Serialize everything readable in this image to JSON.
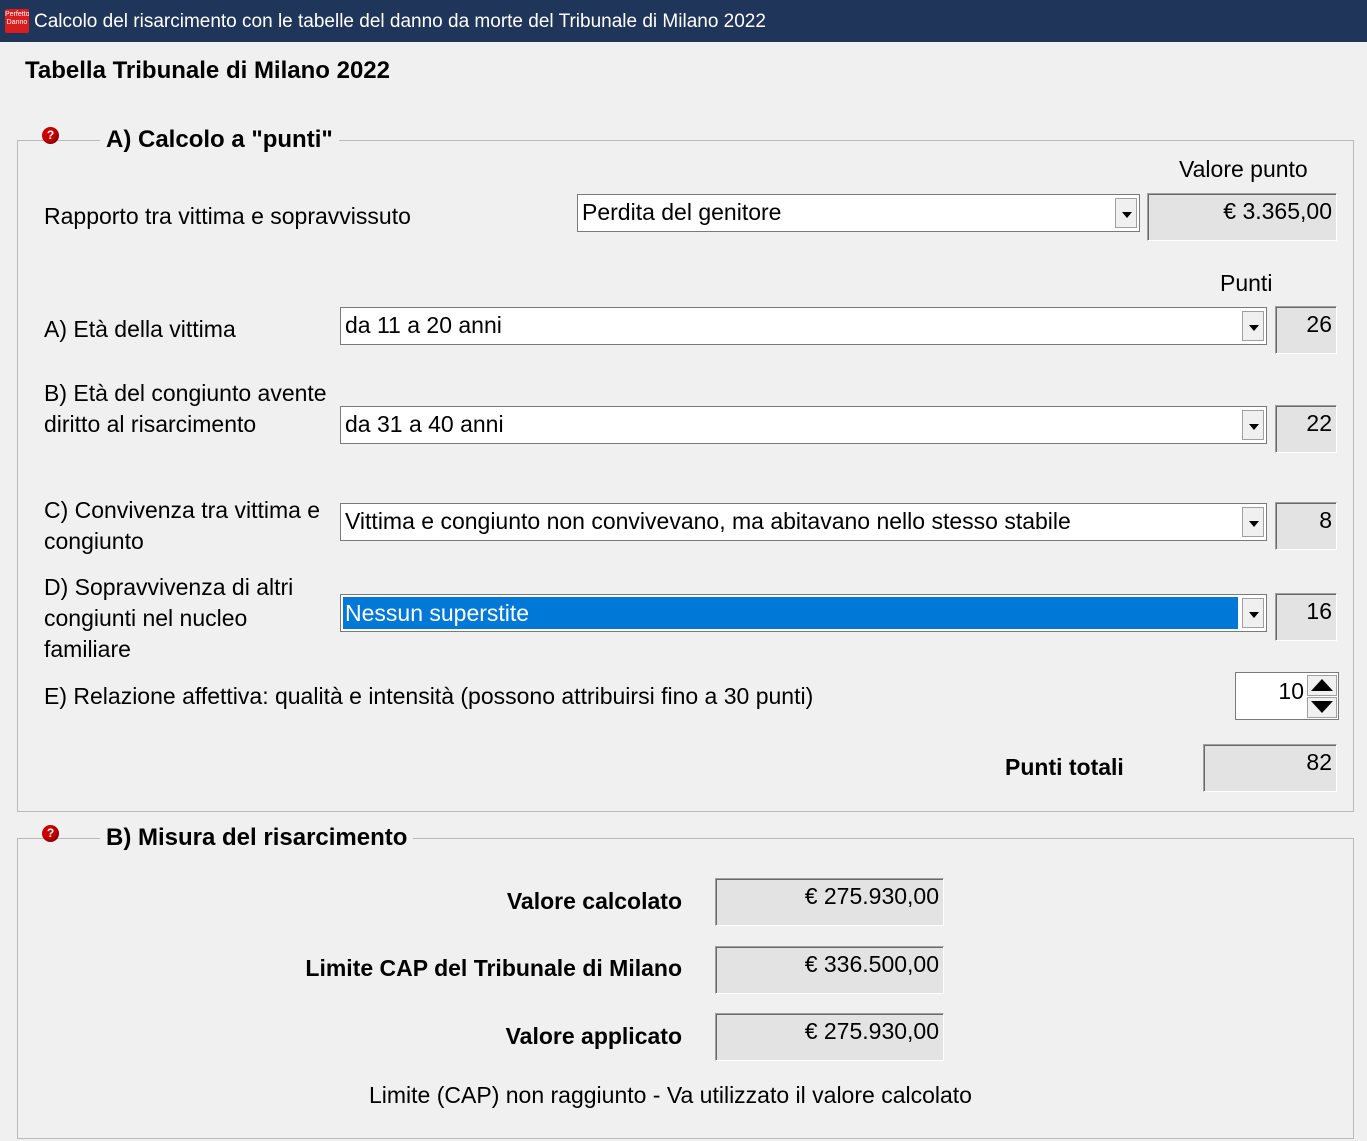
{
  "window": {
    "icon_text": "Perfetto Danno",
    "title": "Calcolo del risarcimento con le tabelle del danno da morte del Tribunale di Milano 2022"
  },
  "heading": "Tabella Tribunale di Milano 2022",
  "section_a": {
    "title": "A) Calcolo a \"punti\"",
    "help_icon": "?",
    "valore_punto_label": "Valore punto",
    "valore_punto": "€ 3.365,00",
    "rapporto_label": "Rapporto tra vittima e sopravvissuto",
    "rapporto_value": "Perdita del genitore",
    "punti_label": "Punti",
    "eta_vittima_label": "A) Età della vittima",
    "eta_vittima_value": "da 11 a 20 anni",
    "eta_vittima_punti": "26",
    "eta_congiunto_label_1": "B) Età del congiunto avente",
    "eta_congiunto_label_2": "diritto al risarcimento",
    "eta_congiunto_value": "da 31 a 40 anni",
    "eta_congiunto_punti": "22",
    "convivenza_label_1": "C) Convivenza tra vittima e",
    "convivenza_label_2": "congiunto",
    "convivenza_value": "Vittima e congiunto non convivevano, ma abitavano nello stesso stabile",
    "convivenza_punti": "8",
    "sopravvivenza_label_1": "D) Sopravvivenza di altri",
    "sopravvivenza_label_2": "congiunti nel nucleo",
    "sopravvivenza_label_3": "familiare",
    "sopravvivenza_value": "Nessun superstite",
    "sopravvivenza_punti": "16",
    "relazione_label": "E) Relazione affettiva: qualità e intensità (possono attribuirsi fino a 30 punti)",
    "relazione_punti": "10",
    "punti_totali_label": "Punti totali",
    "punti_totali": "82"
  },
  "section_b": {
    "title": "B) Misura del risarcimento",
    "help_icon": "?",
    "valore_calcolato_label": "Valore calcolato",
    "valore_calcolato": "€ 275.930,00",
    "limite_cap_label": "Limite CAP del Tribunale di Milano",
    "limite_cap": "€ 336.500,00",
    "valore_applicato_label": "Valore applicato",
    "valore_applicato": "€ 275.930,00",
    "status_message": "Limite (CAP) non raggiunto - Va utilizzato il valore calcolato"
  },
  "colors": {
    "titlebar": "#1f3559",
    "selection": "#0078d7",
    "background": "#f0f0f0"
  }
}
